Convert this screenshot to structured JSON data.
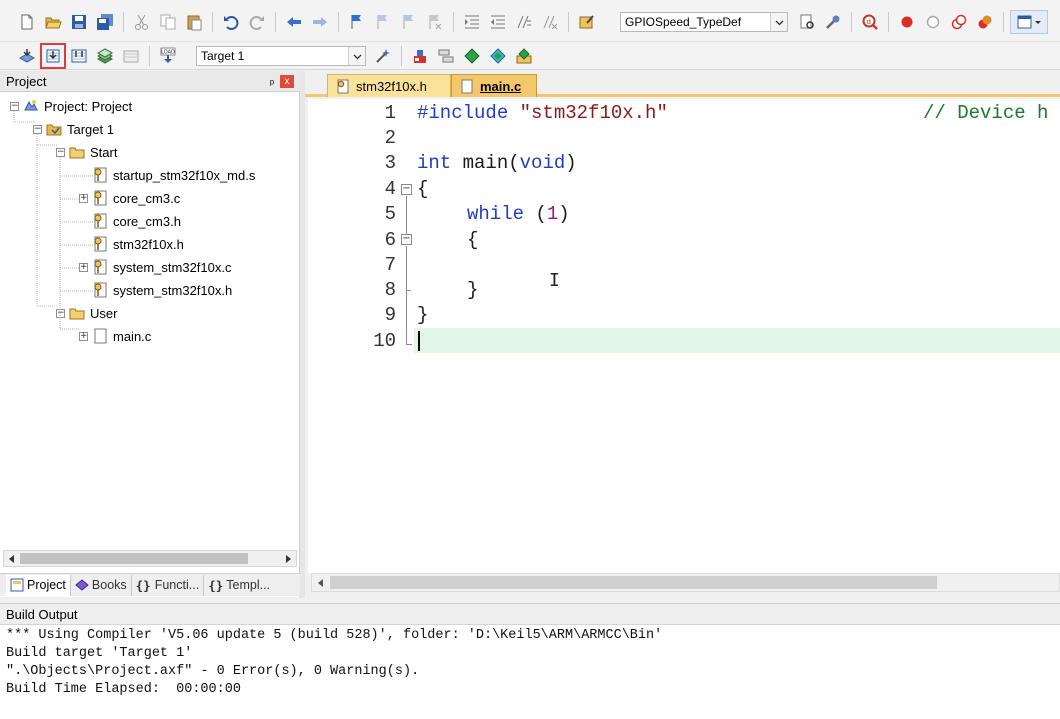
{
  "toolbar1": {
    "function_combo": "GPIOSpeed_TypeDef"
  },
  "toolbar2": {
    "target_combo": "Target 1",
    "load_label": "LOAD"
  },
  "project_panel": {
    "title": "Project",
    "pin": "ᵖ",
    "close": "x",
    "tree": [
      {
        "label": "Project: Project",
        "expander": "−"
      },
      {
        "label": "Target 1",
        "expander": "−"
      },
      {
        "label": "Start",
        "expander": "−"
      },
      {
        "label": "startup_stm32f10x_md.s",
        "expander": ""
      },
      {
        "label": "core_cm3.c",
        "expander": "+"
      },
      {
        "label": "core_cm3.h",
        "expander": ""
      },
      {
        "label": "stm32f10x.h",
        "expander": ""
      },
      {
        "label": "system_stm32f10x.c",
        "expander": "+"
      },
      {
        "label": "system_stm32f10x.h",
        "expander": ""
      },
      {
        "label": "User",
        "expander": "−"
      },
      {
        "label": "main.c",
        "expander": "+"
      }
    ],
    "tabs": [
      "Project",
      "Books",
      "Functi...",
      "Templ..."
    ]
  },
  "editor": {
    "tabs": [
      "stm32f10x.h",
      "main.c"
    ],
    "active_tab": "main.c",
    "line_numbers": [
      "1",
      "2",
      "3",
      "4",
      "5",
      "6",
      "7",
      "8",
      "9",
      "10"
    ],
    "code": {
      "l1_pp": "#include",
      "l1_str": "\"stm32f10x.h\"",
      "l1_cm": "// Device h",
      "l3_type": "int",
      "l3_name": " main(",
      "l3_void": "void",
      "l3_close": ")",
      "l4": "{",
      "l5_kw": "while",
      "l5_open": " (",
      "l5_num": "1",
      "l5_close": ")",
      "l6": "{",
      "l8": "}",
      "l9": "}"
    },
    "current_line": "10",
    "text_cursor": "I"
  },
  "build_output": {
    "title": "Build Output",
    "lines": [
      "*** Using Compiler 'V5.06 update 5 (build 528)', folder: 'D:\\Keil5\\ARM\\ARMCC\\Bin'",
      "Build target 'Target 1'",
      "\".\\Objects\\Project.axf\" - 0 Error(s), 0 Warning(s).",
      "Build Time Elapsed:  00:00:00"
    ]
  },
  "colors": {
    "highlight_box": "#e53935",
    "current_line": "#e2f6e6",
    "active_tab_bar": "#f4c76b",
    "keyword": "#1f3fc0"
  }
}
